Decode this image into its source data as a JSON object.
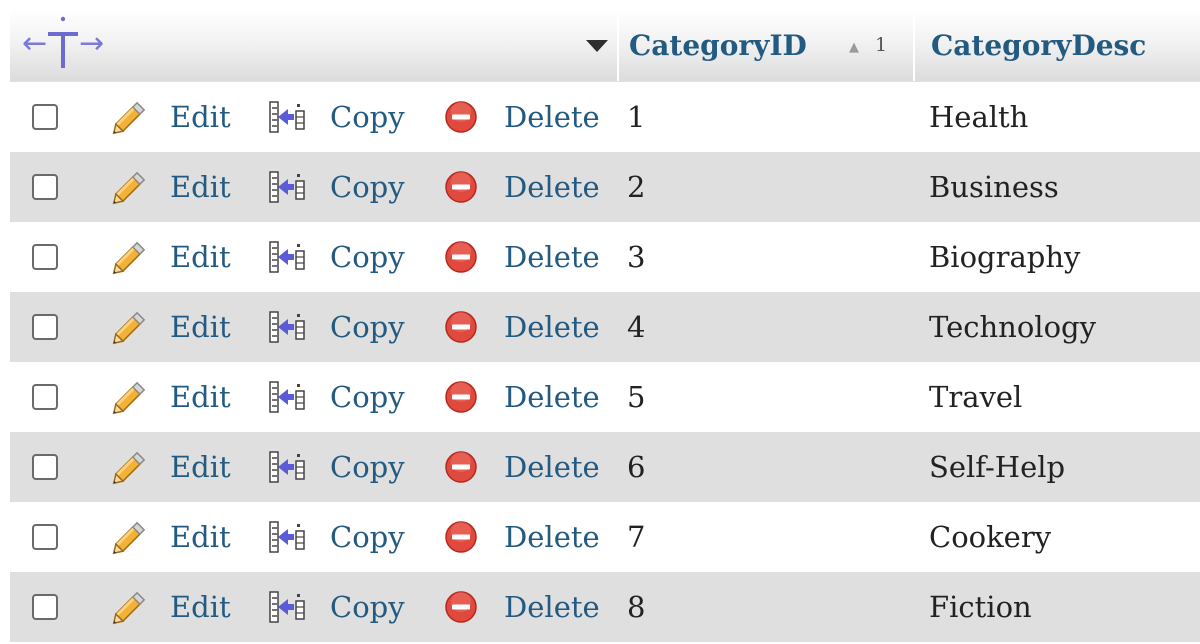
{
  "table": {
    "columns": [
      {
        "label": "CategoryID",
        "sort_indicator": "▲",
        "sort_order": "1"
      },
      {
        "label": "CategoryDesc"
      }
    ],
    "header_arrows": {
      "left": "←",
      "right": "→"
    },
    "actions": {
      "edit": "Edit",
      "copy": "Copy",
      "delete": "Delete"
    },
    "rows": [
      {
        "id": "1",
        "desc": "Health"
      },
      {
        "id": "2",
        "desc": "Business"
      },
      {
        "id": "3",
        "desc": "Biography"
      },
      {
        "id": "4",
        "desc": "Technology"
      },
      {
        "id": "5",
        "desc": "Travel"
      },
      {
        "id": "6",
        "desc": "Self-Help"
      },
      {
        "id": "7",
        "desc": "Cookery"
      },
      {
        "id": "8",
        "desc": "Fiction"
      }
    ]
  },
  "colors": {
    "link": "#235a81",
    "row_alt": "#dfdfdf",
    "header": "#dcdcdc",
    "delete_icon": "#e0493d",
    "pencil_icon": "#e8a02a",
    "copy_icon": "#5b5bd6"
  }
}
